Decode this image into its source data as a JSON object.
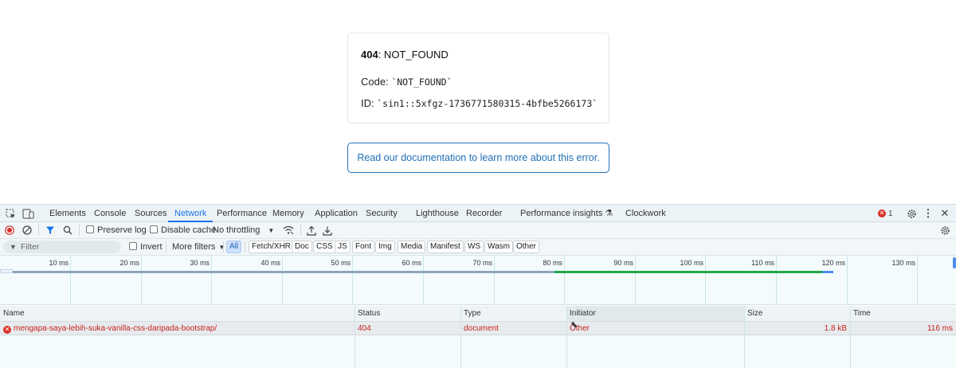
{
  "error_page": {
    "status_code": "404",
    "status_text": ": NOT_FOUND",
    "code_label": "Code: ",
    "code_value": "`NOT_FOUND`",
    "id_label": "ID: ",
    "id_value": "`sin1::5xfgz-1736771580315-4bfbe5266173`",
    "doc_link": "Read our documentation to learn more about this error."
  },
  "devtools": {
    "tabs": [
      "Elements",
      "Console",
      "Sources",
      "Network",
      "Performance",
      "Memory",
      "Application",
      "Security",
      "Lighthouse",
      "Recorder",
      "Performance insights",
      "Clockwork"
    ],
    "active_tab": "Network",
    "error_count": "1",
    "toolbar": {
      "preserve_log": "Preserve log",
      "disable_cache": "Disable cache",
      "throttling": "No throttling"
    },
    "filter": {
      "placeholder": "Filter",
      "invert": "Invert",
      "more_filters": "More filters",
      "types": [
        "All",
        "Fetch/XHR",
        "Doc",
        "CSS",
        "JS",
        "Font",
        "Img",
        "Media",
        "Manifest",
        "WS",
        "Wasm",
        "Other"
      ],
      "active_type": "All"
    },
    "timeline": {
      "ticks": [
        "10 ms",
        "20 ms",
        "30 ms",
        "40 ms",
        "50 ms",
        "60 ms",
        "70 ms",
        "80 ms",
        "90 ms",
        "100 ms",
        "110 ms",
        "120 ms",
        "130 ms"
      ],
      "bar_colors": {
        "waiting": "#8fa4b8",
        "download": "#1fa94a",
        "end": "#4d8ef0"
      }
    },
    "table": {
      "columns": [
        "Name",
        "Status",
        "Type",
        "Initiator",
        "Size",
        "Time"
      ],
      "rows": [
        {
          "name": "mengapa-saya-lebih-suka-vanilla-css-daripada-bootstrap/",
          "status": "404",
          "type": "document",
          "initiator": "Other",
          "size": "1.8 kB",
          "time": "116 ms"
        }
      ]
    }
  },
  "colors": {
    "link": "#1f6fb8",
    "accent": "#1a73e8",
    "error": "#c5221f"
  }
}
